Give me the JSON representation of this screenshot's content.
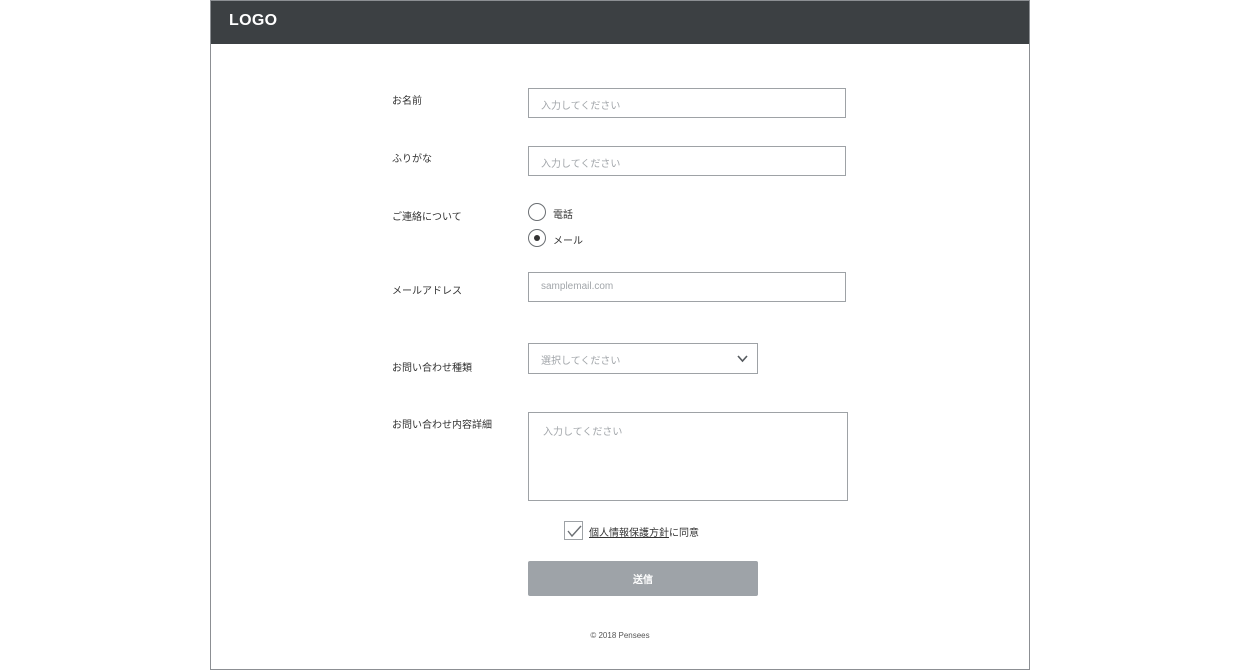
{
  "header": {
    "logo": "LOGO"
  },
  "form": {
    "name": {
      "label": "お名前",
      "placeholder": "入力してください"
    },
    "furigana": {
      "label": "ふりがな",
      "placeholder": "入力してください"
    },
    "contact": {
      "label": "ご連絡について",
      "options": [
        {
          "label": "電話",
          "selected": false
        },
        {
          "label": "メール",
          "selected": true
        }
      ]
    },
    "email": {
      "label": "メールアドレス",
      "placeholder": "samplemail.com"
    },
    "inquiry_type": {
      "label": "お問い合わせ種類",
      "placeholder": "選択してください"
    },
    "inquiry_detail": {
      "label": "お問い合わせ内容詳細",
      "placeholder": "入力してください"
    },
    "agree": {
      "link_text": "個人情報保護方針",
      "suffix": "に同意",
      "checked": true
    },
    "submit_label": "送信"
  },
  "footer": {
    "copyright": "© 2018 Pensees"
  },
  "colors": {
    "header_bg": "#3c4043",
    "button_bg": "#9ea3a8",
    "border": "#9ea2a6",
    "placeholder": "#a2a6aa"
  },
  "icons": {
    "select": "chevron-down-icon",
    "checkbox": "checkmark-icon"
  }
}
